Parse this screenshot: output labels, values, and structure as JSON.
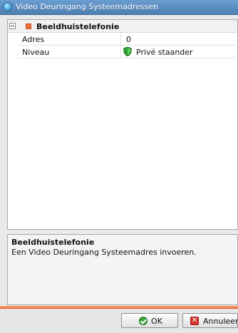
{
  "window": {
    "title": "Video Deuringang Systeemadressen"
  },
  "grid": {
    "category": {
      "label": "Beeldhuistelefonie",
      "expanded": true
    },
    "properties": [
      {
        "name": "Adres",
        "value": "0"
      },
      {
        "name": "Niveau",
        "value": "Privé staander",
        "icon": "green-shield-icon"
      }
    ]
  },
  "description": {
    "title": "Beeldhuistelefonie",
    "text": "Een Video Deuringang Systeemadres invoeren."
  },
  "buttons": {
    "ok_label": "OK",
    "cancel_label": "Annuleer"
  },
  "colors": {
    "titlebar": "#5a8dc2",
    "accent_separator": "#e4632b",
    "category_icon": "#f0703a",
    "shield": "#2e9b2e"
  }
}
